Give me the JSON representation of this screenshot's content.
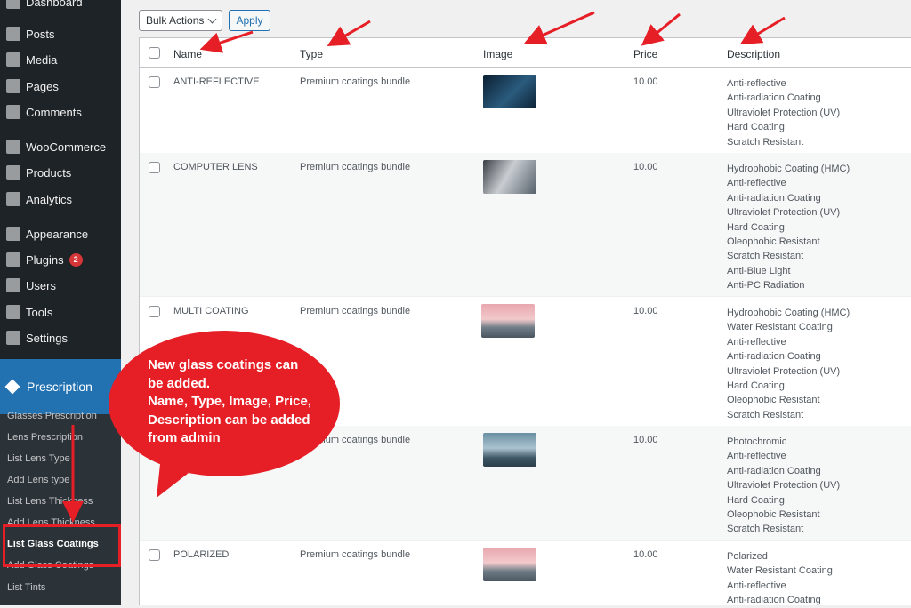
{
  "sidebar": {
    "top_label": "Dashboard",
    "items": [
      {
        "label": "Posts",
        "icon": "pin-icon"
      },
      {
        "label": "Media",
        "icon": "media-icon"
      },
      {
        "label": "Pages",
        "icon": "pages-icon"
      },
      {
        "label": "Comments",
        "icon": "comments-icon"
      },
      {
        "label": "WooCommerce",
        "icon": "woocommerce-icon"
      },
      {
        "label": "Products",
        "icon": "products-icon"
      },
      {
        "label": "Analytics",
        "icon": "analytics-icon"
      },
      {
        "label": "Appearance",
        "icon": "brush-icon"
      },
      {
        "label": "Plugins",
        "icon": "plugins-icon",
        "badge": "2"
      },
      {
        "label": "Users",
        "icon": "users-icon"
      },
      {
        "label": "Tools",
        "icon": "wrench-icon"
      },
      {
        "label": "Settings",
        "icon": "settings-icon"
      }
    ],
    "active_section": "Prescription",
    "submenu": [
      "Glasses Prescription",
      "Lens Prescription",
      "List Lens Type",
      "Add Lens type",
      "List Lens Thickness",
      "Add Lens Thickness",
      "List Glass Coatings",
      "Add Glass Coatings",
      "List Tints"
    ],
    "current_submenu": "List Glass Coatings"
  },
  "toolbar": {
    "bulk_actions_label": "Bulk Actions",
    "apply_label": "Apply"
  },
  "table": {
    "headers": {
      "name": "Name",
      "type": "Type",
      "image": "Image",
      "price": "Price",
      "description": "Description"
    },
    "rows": [
      {
        "name": "ANTI-REFLECTIVE",
        "type": "Premium coatings bundle",
        "price": "10.00",
        "description": [
          "Anti-reflective",
          "Anti-radiation Coating",
          "Ultraviolet Protection (UV)",
          "Hard Coating",
          "Scratch Resistant"
        ]
      },
      {
        "name": "COMPUTER LENS",
        "type": "Premium coatings bundle",
        "price": "10.00",
        "description": [
          "Hydrophobic Coating (HMC)",
          "Anti-reflective",
          "Anti-radiation Coating",
          "Ultraviolet Protection (UV)",
          "Hard Coating",
          "Oleophobic Resistant",
          "Scratch Resistant",
          "Anti-Blue Light",
          "Anti-PC Radiation"
        ]
      },
      {
        "name": "MULTI COATING",
        "type": "Premium coatings bundle",
        "price": "10.00",
        "description": [
          "Hydrophobic Coating (HMC)",
          "Water Resistant Coating",
          "Anti-reflective",
          "Anti-radiation Coating",
          "Ultraviolet Protection (UV)",
          "Hard Coating",
          "Oleophobic Resistant",
          "Scratch Resistant"
        ]
      },
      {
        "name": "",
        "type": "Premium coatings bundle",
        "price": "10.00",
        "description": [
          "Photochromic",
          "Anti-reflective",
          "Anti-radiation Coating",
          "Ultraviolet Protection (UV)",
          "Hard Coating",
          "Oleophobic Resistant",
          "Scratch Resistant"
        ]
      },
      {
        "name": "POLARIZED",
        "type": "Premium coatings bundle",
        "price": "10.00",
        "description": [
          "Polarized",
          "Water Resistant Coating",
          "Anti-reflective",
          "Anti-radiation Coating"
        ]
      }
    ]
  },
  "callout": {
    "lines": [
      "New glass coatings can",
      "be added.",
      "Name, Type, Image, Price,",
      "Description can be added",
      "from admin"
    ]
  },
  "colors": {
    "annotation": "#e61e25",
    "sidebar": "#1d2327",
    "active": "#2271b1"
  }
}
